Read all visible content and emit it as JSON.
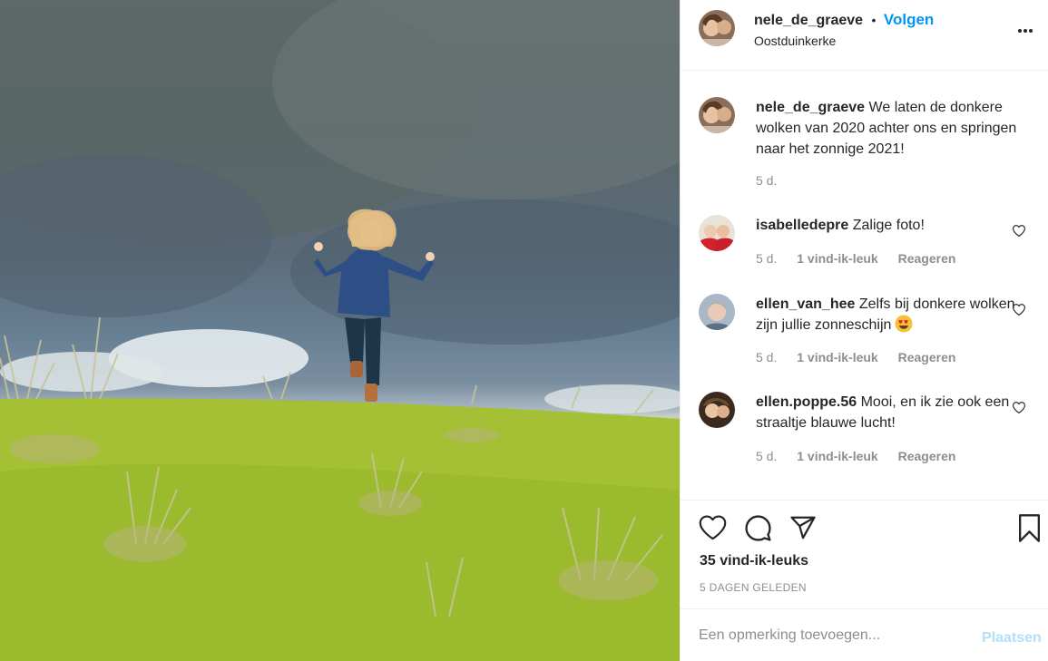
{
  "post": {
    "author": "nele_de_graeve",
    "follow_label": "Volgen",
    "separator": "•",
    "location": "Oostduinkerke",
    "more_label": "•••"
  },
  "caption": {
    "user": "nele_de_graeve",
    "text": "We laten de donkere wolken van 2020 achter ons en springen naar het zonnige 2021!",
    "age": "5 d."
  },
  "comments": [
    {
      "user": "isabelledepre",
      "text": "Zalige foto!",
      "age": "5 d.",
      "likes": "1 vind-ik-leuk",
      "reply": "Reageren"
    },
    {
      "user": "ellen_van_hee",
      "text": "Zelfs bij donkere wolken zijn jullie zonneschijn",
      "emoji": "heart-eyes-emoji",
      "age": "5 d.",
      "likes": "1 vind-ik-leuk",
      "reply": "Reageren"
    },
    {
      "user": "ellen.poppe.56",
      "text": "Mooi, en ik zie ook een straaltje blauwe lucht!",
      "age": "5 d.",
      "likes": "1 vind-ik-leuk",
      "reply": "Reageren"
    }
  ],
  "engagement": {
    "likes": "35 vind-ik-leuks",
    "date": "5 DAGEN GELEDEN"
  },
  "add_comment": {
    "placeholder": "Een opmerking toevoegen...",
    "post_label": "Plaatsen"
  },
  "colors": {
    "accent": "#0095f6",
    "post_disabled": "#b2dffc",
    "muted": "#8e8e8e"
  }
}
